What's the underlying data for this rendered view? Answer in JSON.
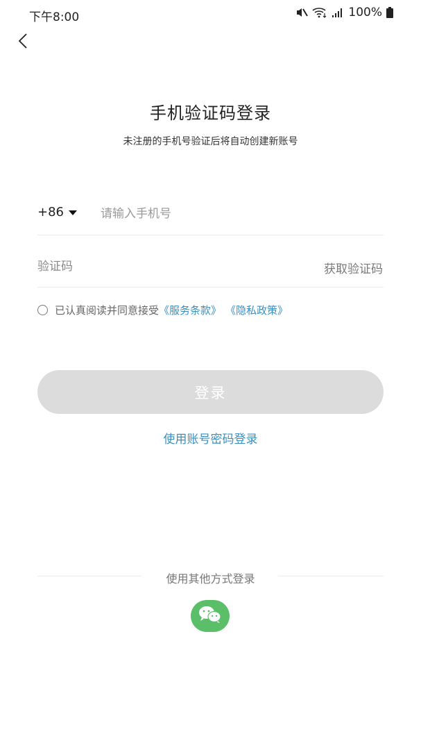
{
  "status_bar": {
    "time": "下午8:00",
    "battery": "100%",
    "icons": [
      "mute-icon",
      "wifi-icon",
      "signal-icon",
      "battery-icon"
    ]
  },
  "header": {
    "back_icon": "chevron-left-icon"
  },
  "main": {
    "title": "手机验证码登录",
    "subtitle": "未注册的手机号验证后将自动创建新账号",
    "country_code": "+86",
    "phone_placeholder": "请输入手机号",
    "code_placeholder": "验证码",
    "get_code_label": "获取验证码",
    "agreement": {
      "text": "已认真阅读并同意接受",
      "terms_link": "《服务条款》",
      "privacy_link": "《隐私政策》"
    },
    "login_button": "登录",
    "password_login_link": "使用账号密码登录"
  },
  "other_login": {
    "label": "使用其他方式登录",
    "methods": [
      "wechat-icon"
    ]
  },
  "colors": {
    "link": "#3a8fc0",
    "button_disabled": "#dcdcdc",
    "wechat": "#5bbf6a"
  }
}
